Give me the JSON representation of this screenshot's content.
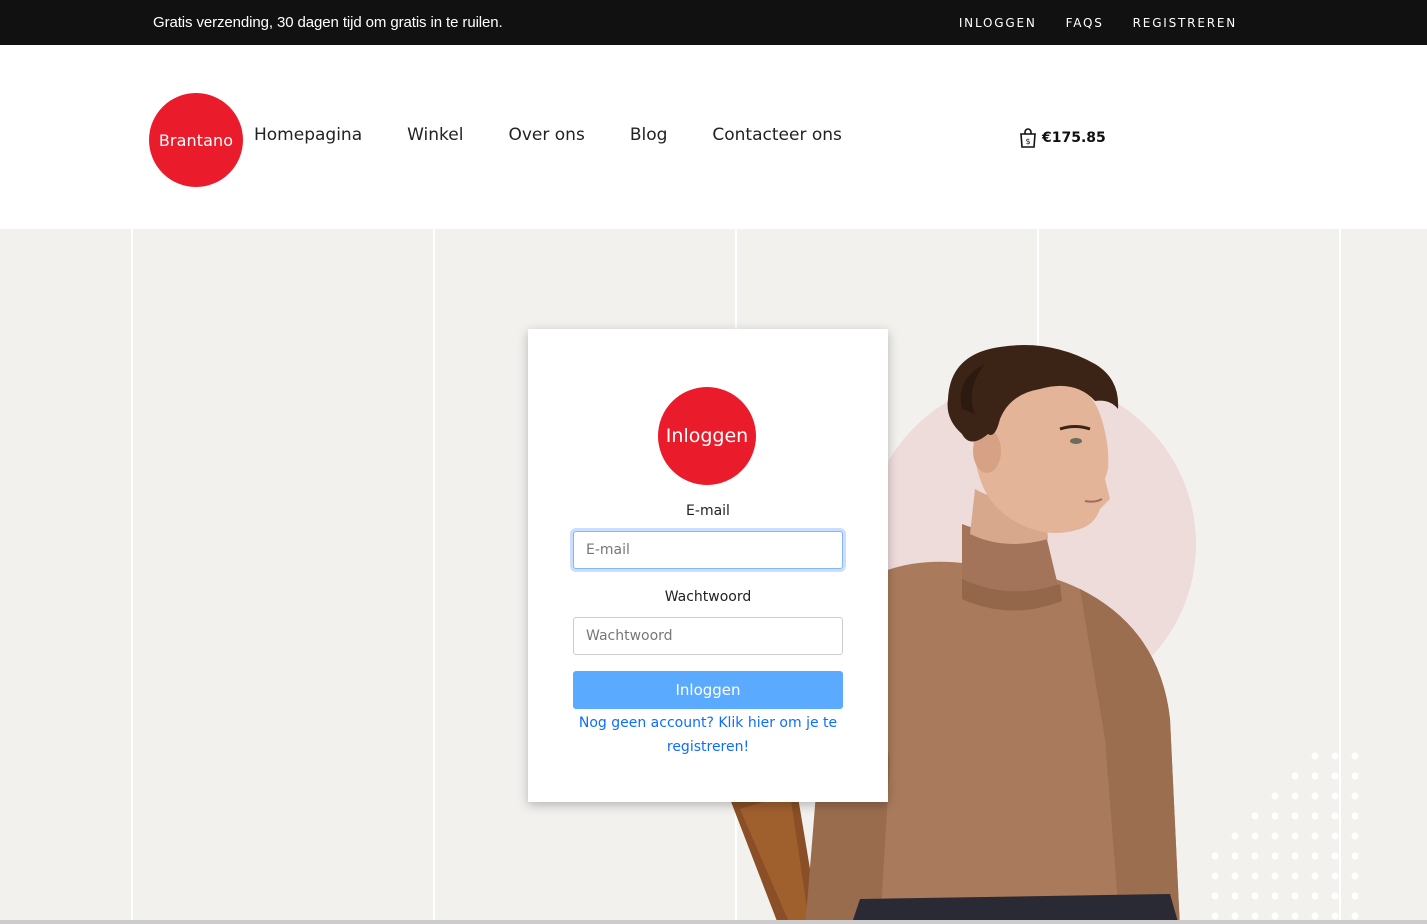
{
  "topbar": {
    "promo": "Gratis verzending, 30 dagen tijd om gratis in te ruilen.",
    "links": [
      "INLOGGEN",
      "FAQS",
      "REGISTREREN"
    ]
  },
  "header": {
    "logo_text": "Brantano",
    "nav": [
      "Homepagina",
      "Winkel",
      "Over ons",
      "Blog",
      "Contacteer ons"
    ],
    "cart_icon": "shopping-bag-icon",
    "cart_total": "€175.85"
  },
  "login": {
    "badge": "Inloggen",
    "email_label": "E-mail",
    "email_placeholder": "E-mail",
    "password_label": "Wachtwoord",
    "password_placeholder": "Wachtwoord",
    "submit_label": "Inloggen",
    "register_link": "Nog geen account? Klik hier om je te registreren!"
  },
  "colors": {
    "brand_red": "#ea1b2a",
    "button_blue": "#5aabff",
    "link_blue": "#0d6efd",
    "topbar_bg": "#111111",
    "hero_bg": "#f2f1ee"
  }
}
